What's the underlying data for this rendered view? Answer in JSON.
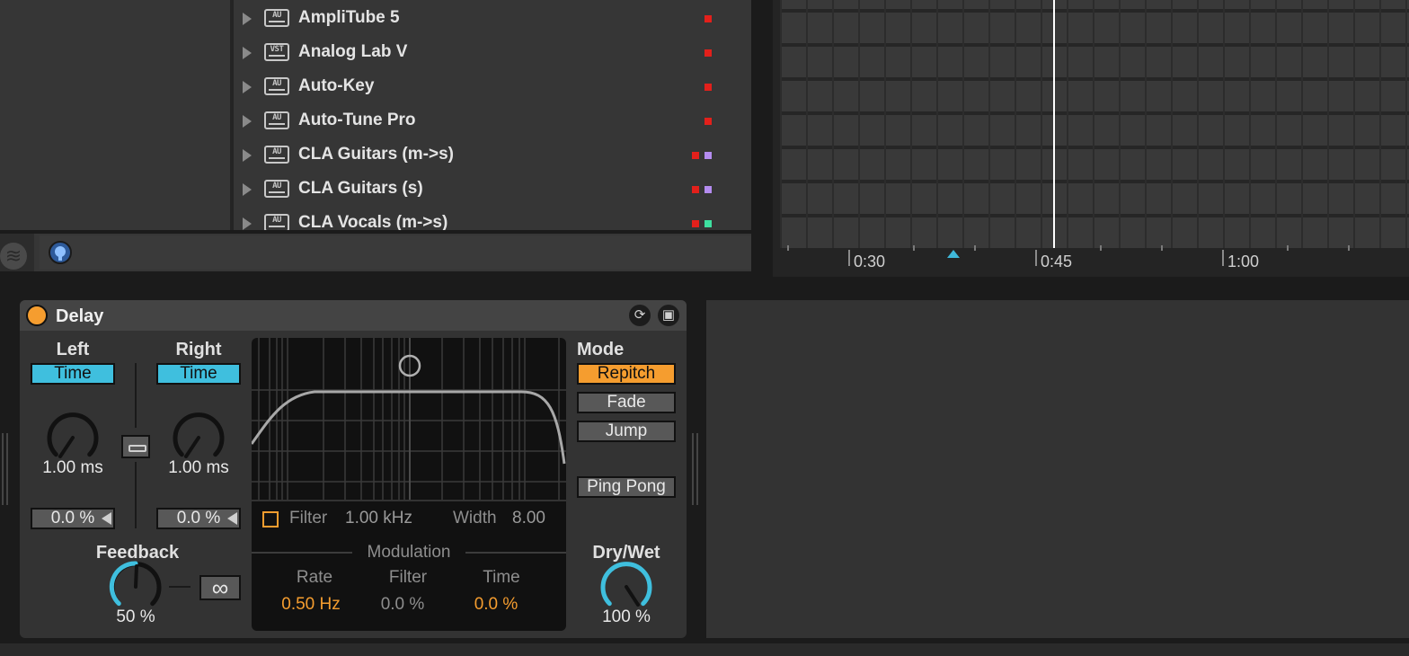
{
  "browser": {
    "plugins": [
      {
        "name": "AmpliTube 5",
        "type": "AU",
        "tags": [
          "#e3201b"
        ]
      },
      {
        "name": "Analog Lab V",
        "type": "VST",
        "tags": [
          "#e3201b"
        ]
      },
      {
        "name": "Auto-Key",
        "type": "AU",
        "tags": [
          "#e3201b"
        ]
      },
      {
        "name": "Auto-Tune Pro",
        "type": "AU",
        "tags": [
          "#e3201b"
        ]
      },
      {
        "name": "CLA Guitars (m->s)",
        "type": "AU",
        "tags": [
          "#e3201b",
          "#b48cf0"
        ]
      },
      {
        "name": "CLA Guitars (s)",
        "type": "AU",
        "tags": [
          "#e3201b",
          "#b48cf0"
        ]
      },
      {
        "name": "CLA Vocals (m->s)",
        "type": "AU",
        "tags": [
          "#e3201b",
          "#3ee0a0"
        ]
      }
    ],
    "footer_icons": [
      "waves-icon",
      "hot-swap-icon"
    ]
  },
  "arrangement": {
    "ruler_labels": [
      "0:30",
      "0:45",
      "1:00"
    ],
    "colors": {
      "playhead": "#ffffff",
      "loop_marker": "#3fb8d9"
    }
  },
  "device": {
    "title": "Delay",
    "power_on": true,
    "header_icons": [
      "hot-swap-icon",
      "save-preset-icon"
    ],
    "left": {
      "label": "Left",
      "mode_button": "Time",
      "time_value": "1.00 ms",
      "offset": "0.0 %"
    },
    "right": {
      "label": "Right",
      "mode_button": "Time",
      "time_value": "1.00 ms",
      "offset": "0.0 %"
    },
    "feedback": {
      "label": "Feedback",
      "value": "50 %",
      "freeze_symbol": "∞"
    },
    "filter": {
      "label": "Filter",
      "freq": "1.00 kHz",
      "width_label": "Width",
      "width_value": "8.00",
      "enabled": false
    },
    "modulation": {
      "title": "Modulation",
      "rate_label": "Rate",
      "rate_value": "0.50 Hz",
      "filter_label": "Filter",
      "filter_value": "0.0 %",
      "time_label": "Time",
      "time_value": "0.0 %"
    },
    "mode": {
      "label": "Mode",
      "options": [
        "Repitch",
        "Fade",
        "Jump"
      ],
      "selected": "Repitch"
    },
    "ping_pong": "Ping Pong",
    "dry_wet": {
      "label": "Dry/Wet",
      "value": "100 %"
    },
    "colors": {
      "accent_orange": "#f59d2f",
      "accent_blue": "#3fbfde"
    }
  }
}
